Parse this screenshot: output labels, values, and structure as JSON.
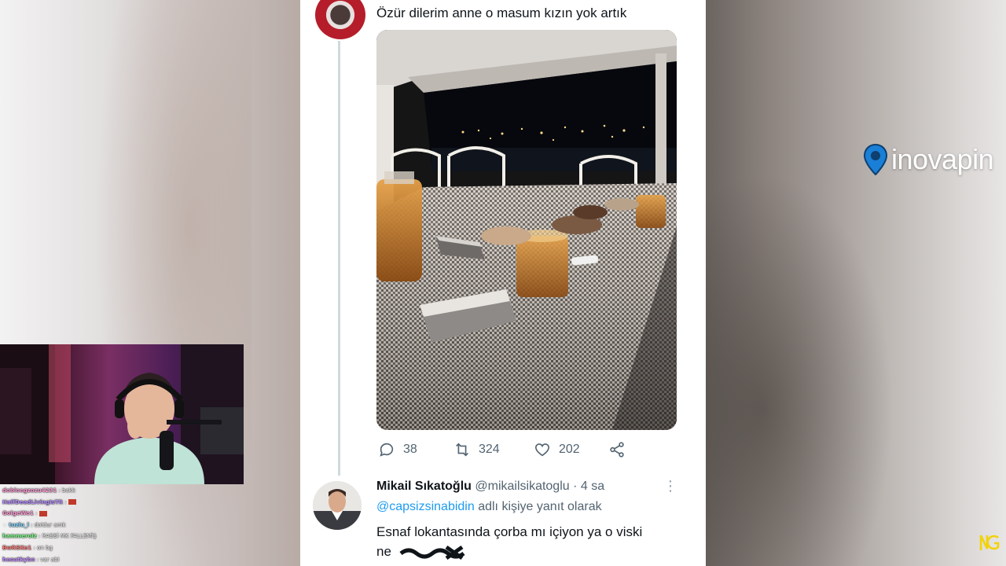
{
  "tweet": {
    "text": "Özür dilerim anne o masum kızın yok artık",
    "stats": {
      "replies": "38",
      "retweets": "324",
      "likes": "202"
    }
  },
  "reply": {
    "name": "Mikail Sıkatoğlu",
    "handle": "@mikailsikatoglu",
    "time": "· 4 sa",
    "more": "⋮",
    "mention": "@capsizsinabidin",
    "reply_note": "adlı kişiye yanıt olarak",
    "text_line1": "Esnaf lokantasında çorba mı içiyon ya o viski",
    "text_line2": "ne"
  },
  "chat": [
    {
      "user": "dobloegzozu4231",
      "message": ": bakk",
      "color": "#ff9ad5"
    },
    {
      "user": "HalfDeadLivingIsTR",
      "message": ":",
      "color": "#b58cff"
    },
    {
      "user": "GolgeWo1",
      "message": ":",
      "color": "#ff9ad5"
    },
    {
      "user": "tuzlu_l",
      "message": ": doldur amk",
      "color": "#7fd4ff"
    },
    {
      "user": "hammerolz",
      "message": ": RABBİ MK FALLEMİŞ",
      "color": "#7dff8a"
    },
    {
      "user": "BwRSKe1",
      "message": ": on bg",
      "color": "#ff7a7a"
    },
    {
      "user": "hesutkybn",
      "message": ": var abi",
      "color": "#c08cff"
    }
  ],
  "brand": {
    "name": "inovapin"
  },
  "colors": {
    "link": "#1d9bf0",
    "text": "#0f1419",
    "muted": "#536471",
    "brand_pin": "#1a7fd6",
    "corner_logo": "#f2d20a"
  },
  "icons": [
    "reply-icon",
    "retweet-icon",
    "like-icon",
    "share-icon",
    "location-pin-icon"
  ]
}
